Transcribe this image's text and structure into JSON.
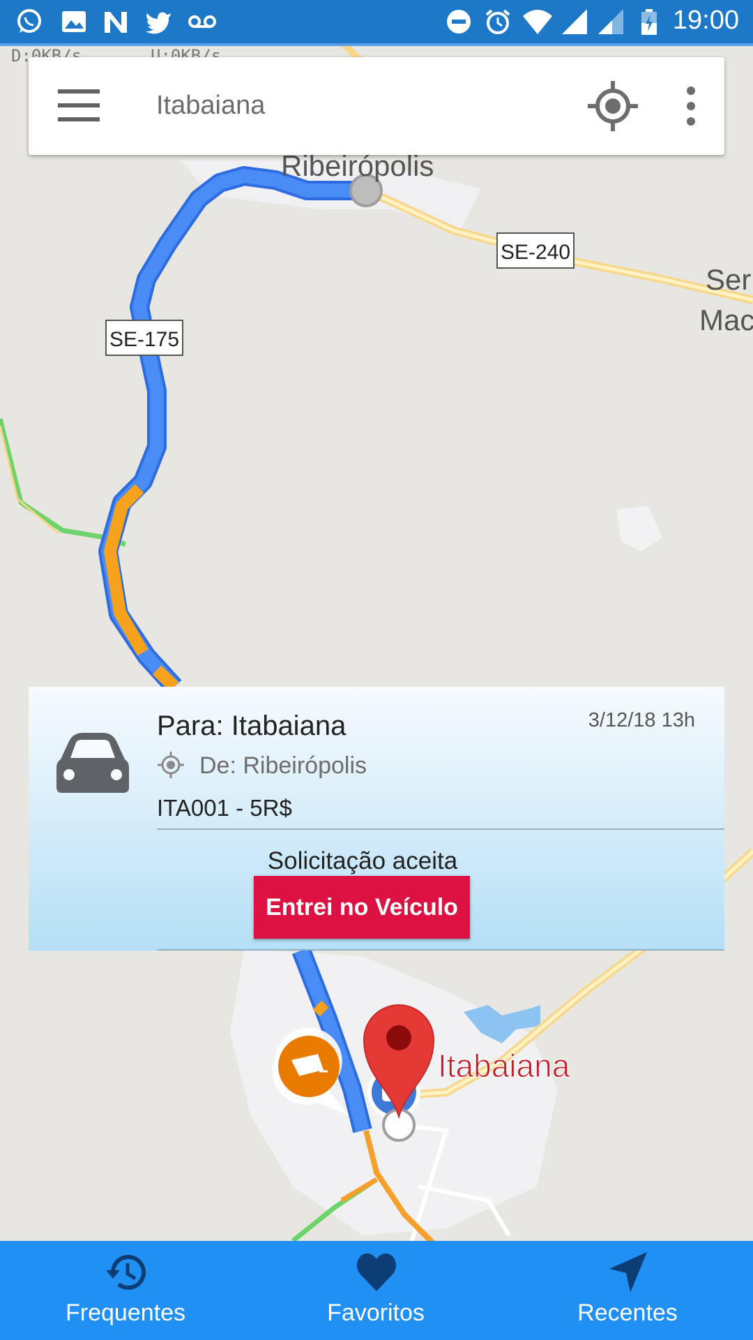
{
  "status_bar": {
    "time": "19:00",
    "download_speed": "D:0KB/s",
    "upload_speed": "U:0KB/s",
    "left_icons": [
      "whatsapp-icon",
      "image-icon",
      "n-icon",
      "twitter-icon",
      "voicemail-icon"
    ],
    "right_icons": [
      "dnd-icon",
      "alarm-icon",
      "wifi-icon",
      "signal-icon",
      "signal-icon-2",
      "battery-charging-icon"
    ]
  },
  "search_bar": {
    "title": "Itabaiana",
    "icons": [
      "menu-icon",
      "my-location-icon",
      "more-vert-icon"
    ]
  },
  "map": {
    "labels": {
      "ribeiropolis": "Ribeirópolis",
      "se240": "SE-240",
      "se175": "SE-175",
      "ser": "Ser",
      "mac": "Mac",
      "itabaiana": "Itabaiana"
    },
    "colors": {
      "route": "#4285f4",
      "traffic_slow": "#f7a21c",
      "pin": "#e53935",
      "camera": "#ef7d00"
    }
  },
  "ride_card": {
    "destination": "Para: Itabaiana",
    "origin": "De: Ribeirópolis",
    "date": "3/12/18 13h",
    "code_price": "ITA001 - 5R$",
    "status": "Solicitação aceita",
    "button_label": "Entrei no Veículo",
    "button_color": "#dc1342"
  },
  "bottom_nav": {
    "items": [
      {
        "label": "Frequentes",
        "icon": "history-icon"
      },
      {
        "label": "Favoritos",
        "icon": "heart-icon"
      },
      {
        "label": "Recentes",
        "icon": "navigation-icon"
      }
    ],
    "background": "#2190f4"
  }
}
